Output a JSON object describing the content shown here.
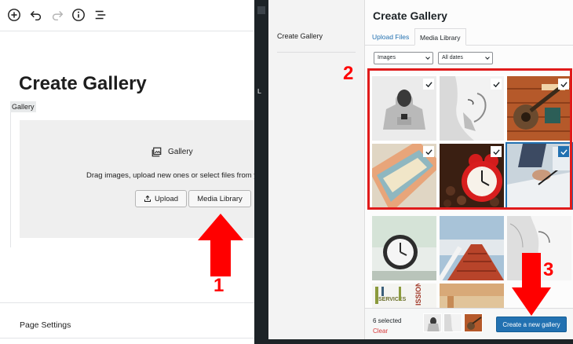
{
  "editor": {
    "page_title": "Create Gallery",
    "block_label": "Gallery",
    "placeholder": {
      "heading": "Gallery",
      "instructions": "Drag images, upload new ones or select files from your library.",
      "upload_label": "Upload",
      "media_library_label": "Media Library"
    },
    "page_settings": "Page Settings",
    "toolbar_icons": [
      "add-block-icon",
      "undo-icon",
      "redo-icon",
      "info-icon",
      "list-view-icon"
    ]
  },
  "modal": {
    "title": "Create Gallery",
    "menu_items": [
      "Create Gallery"
    ],
    "tabs": [
      {
        "label": "Upload Files",
        "active": false
      },
      {
        "label": "Media Library",
        "active": true
      }
    ],
    "filters": {
      "type_value": "Images",
      "date_value": "All dates"
    },
    "footer": {
      "selected_count": "6 selected",
      "clear_label": "Clear",
      "create_button": "Create a new gallery"
    },
    "attachments": [
      {
        "subject": "hoodie",
        "selected": true
      },
      {
        "subject": "praying-woman",
        "selected": true
      },
      {
        "subject": "guitar-on-wood",
        "selected": true
      },
      {
        "subject": "sandwich",
        "selected": true
      },
      {
        "subject": "alarm-clock-coffee",
        "selected": true
      },
      {
        "subject": "writing-hands",
        "selected": true
      },
      {
        "subject": "clock",
        "selected": false
      },
      {
        "subject": "stairs",
        "selected": false
      },
      {
        "subject": "woman-profile",
        "selected": false
      },
      {
        "subject": "word-cloud",
        "selected": false
      },
      {
        "subject": "orange-street",
        "selected": false
      }
    ],
    "word_cloud_words": [
      "SERVICES",
      "ISSION"
    ]
  },
  "annotations": {
    "numbers": [
      "1",
      "2",
      "3"
    ],
    "color": "#ff0000"
  },
  "colors": {
    "accent": "#2271b1",
    "annotation": "#ff0000"
  }
}
